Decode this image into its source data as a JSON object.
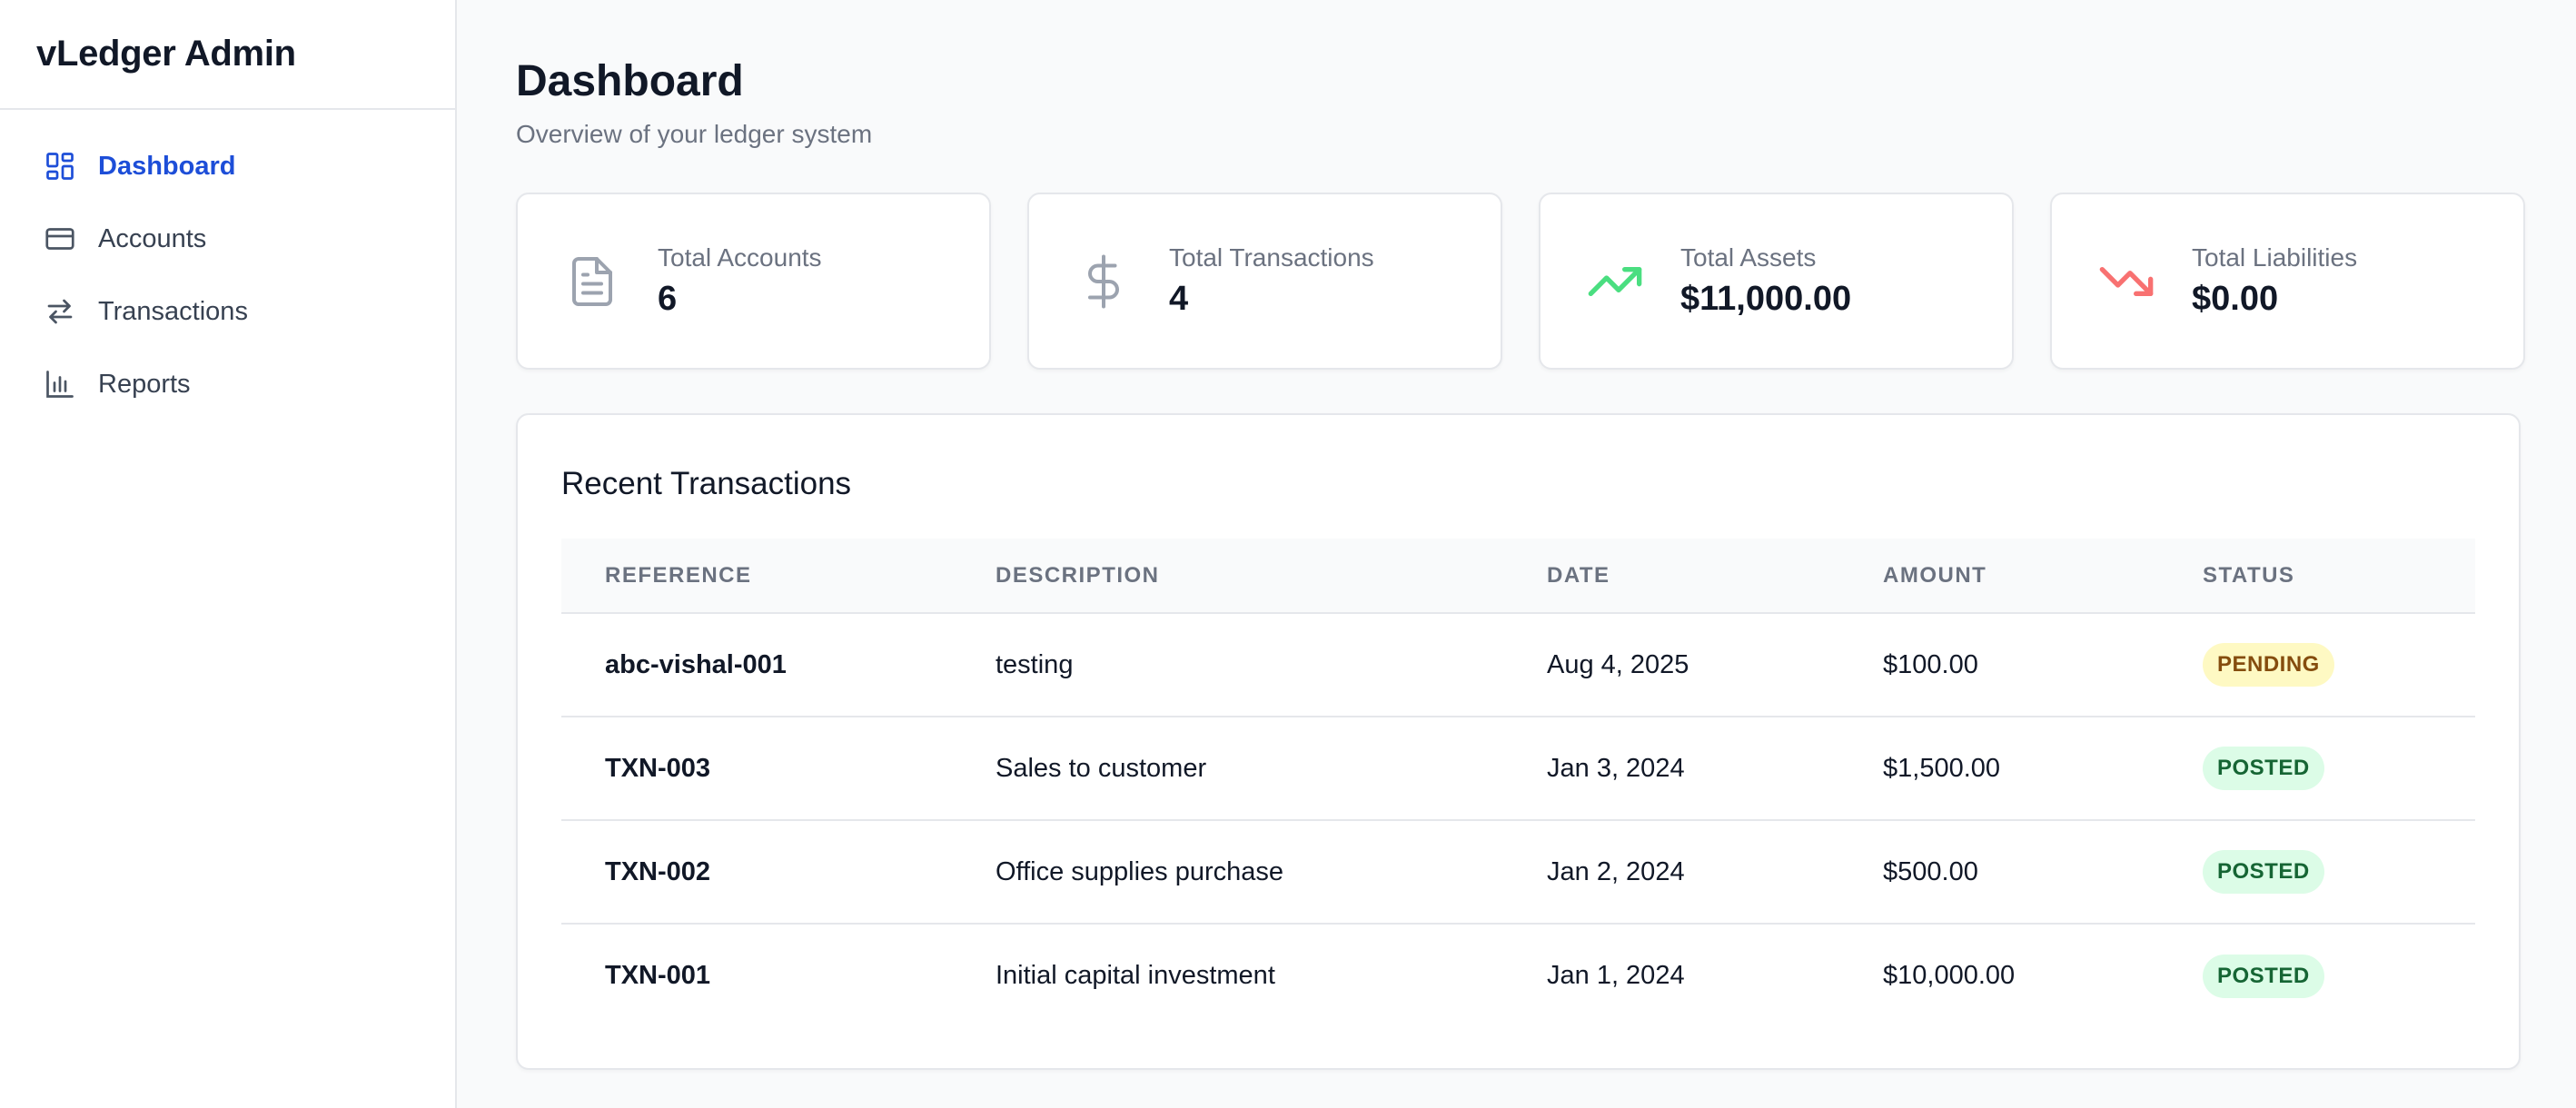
{
  "app": {
    "brand": "vLedger Admin"
  },
  "sidebar": {
    "items": [
      {
        "label": "Dashboard",
        "icon": "dashboard-grid-icon",
        "active": true
      },
      {
        "label": "Accounts",
        "icon": "credit-card-icon",
        "active": false
      },
      {
        "label": "Transactions",
        "icon": "arrows-swap-icon",
        "active": false
      },
      {
        "label": "Reports",
        "icon": "bar-chart-icon",
        "active": false
      }
    ]
  },
  "header": {
    "title": "Dashboard",
    "subtitle": "Overview of your ledger system"
  },
  "stats": [
    {
      "label": "Total Accounts",
      "value": "6",
      "icon": "document-icon",
      "color": "#9ca3af"
    },
    {
      "label": "Total Transactions",
      "value": "4",
      "icon": "dollar-icon",
      "color": "#9ca3af"
    },
    {
      "label": "Total Assets",
      "value": "$11,000.00",
      "icon": "trending-up-icon",
      "color": "#4ade80"
    },
    {
      "label": "Total Liabilities",
      "value": "$0.00",
      "icon": "trending-down-icon",
      "color": "#f87171"
    }
  ],
  "recent": {
    "title": "Recent Transactions",
    "columns": [
      "Reference",
      "Description",
      "Date",
      "Amount",
      "Status"
    ],
    "rows": [
      {
        "reference": "abc-vishal-001",
        "description": "testing",
        "date": "Aug 4, 2025",
        "amount": "$100.00",
        "status": "PENDING"
      },
      {
        "reference": "TXN-003",
        "description": "Sales to customer",
        "date": "Jan 3, 2024",
        "amount": "$1,500.00",
        "status": "POSTED"
      },
      {
        "reference": "TXN-002",
        "description": "Office supplies purchase",
        "date": "Jan 2, 2024",
        "amount": "$500.00",
        "status": "POSTED"
      },
      {
        "reference": "TXN-001",
        "description": "Initial capital investment",
        "date": "Jan 1, 2024",
        "amount": "$10,000.00",
        "status": "POSTED"
      }
    ]
  },
  "colors": {
    "accent": "#1d4ed8",
    "pending_bg": "#fef9c3",
    "pending_text": "#854d0e",
    "posted_bg": "#dcfce7",
    "posted_text": "#166534"
  }
}
